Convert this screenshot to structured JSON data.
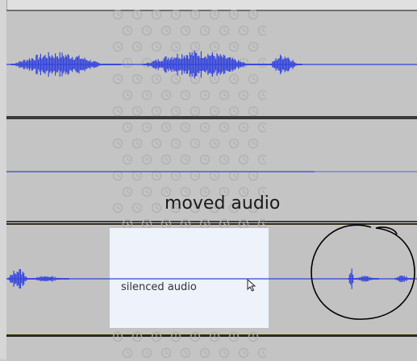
{
  "annotations": {
    "moved_label": "moved audio",
    "silenced_label": "silenced audio"
  },
  "colors": {
    "waveform": "#3344dd",
    "track_bg": "#c4c4c4",
    "selection": "#eef2fb",
    "marker": "#000000"
  },
  "icons": [
    "clock-watermark-icon",
    "arrow-cursor-icon",
    "hand-drawn-circle"
  ]
}
